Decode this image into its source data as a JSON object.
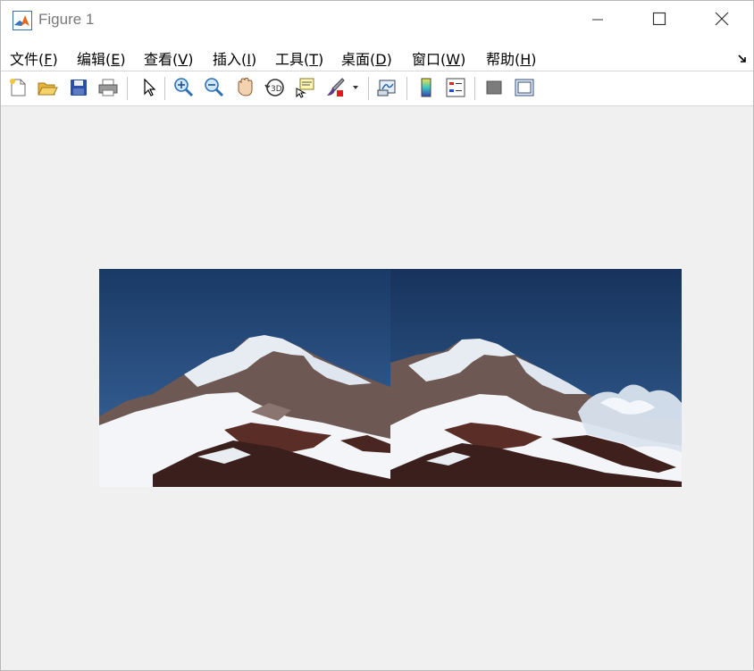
{
  "window": {
    "title": "Figure 1",
    "app_icon": "matlab-logo-icon",
    "controls": [
      "minimize-icon",
      "maximize-icon",
      "close-icon"
    ]
  },
  "menubar": {
    "items": [
      {
        "label": "文件(",
        "mnemonic": "F",
        "suffix": ")"
      },
      {
        "label": "编辑(",
        "mnemonic": "E",
        "suffix": ")"
      },
      {
        "label": "查看(",
        "mnemonic": "V",
        "suffix": ")"
      },
      {
        "label": "插入(",
        "mnemonic": "I",
        "suffix": ")"
      },
      {
        "label": "工具(",
        "mnemonic": "T",
        "suffix": ")"
      },
      {
        "label": "桌面(",
        "mnemonic": "D",
        "suffix": ")"
      },
      {
        "label": "窗口(",
        "mnemonic": "W",
        "suffix": ")"
      },
      {
        "label": "帮助(",
        "mnemonic": "H",
        "suffix": ")"
      }
    ],
    "dock_icon": "dock-arrow-icon"
  },
  "toolbar": {
    "tools": [
      "new-figure-icon",
      "open-file-icon",
      "save-icon",
      "print-icon",
      "edit-plot-arrow-icon",
      "zoom-in-icon",
      "zoom-out-icon",
      "pan-hand-icon",
      "rotate-3d-icon",
      "data-cursor-icon",
      "brush-icon",
      "link-plot-icon",
      "insert-colorbar-icon",
      "insert-legend-icon",
      "hide-plot-tools-icon",
      "show-plot-tools-icon"
    ]
  },
  "figure": {
    "images": [
      {
        "name": "mountain-image-left",
        "description_hidden": true
      },
      {
        "name": "mountain-image-right",
        "description_hidden": true
      }
    ],
    "colors": {
      "sky": "#1d3f6e",
      "snow": "#f1f3f6",
      "rock": "#4a2a22",
      "background": "#f0f0f0"
    }
  }
}
